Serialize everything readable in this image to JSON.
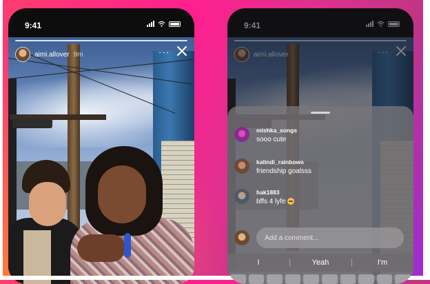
{
  "statusbar": {
    "time": "9:41"
  },
  "story": {
    "username": "aimi.allover",
    "posted": "9m",
    "more_label": "···"
  },
  "comments_sheet": {
    "comments": [
      {
        "user": "mishka_songs",
        "message": "sooo cute",
        "avatar_color": "#8a2a8f"
      },
      {
        "user": "kalindi_rainbows",
        "message": "friendship goalsss",
        "avatar_color": "#6b4a3a"
      },
      {
        "user": "hak1883",
        "message": "bffs 4 lyfe",
        "avatar_color": "#4b5a6a"
      }
    ],
    "input_placeholder": "Add a comment..."
  },
  "keyboard": {
    "suggestions": [
      "I",
      "Yeah",
      "I'm"
    ]
  },
  "colors": {
    "bg_pink": "#ff1f8e",
    "bg_purple": "#9b2bd8",
    "bg_orange": "#ff8c28"
  }
}
